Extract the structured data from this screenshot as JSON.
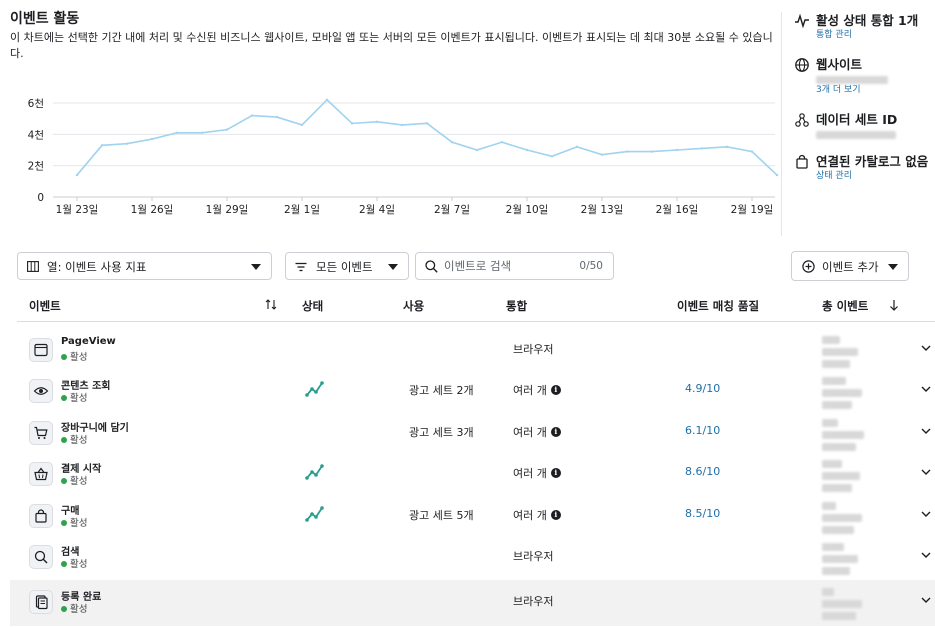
{
  "activity": {
    "title": "이벤트 활동",
    "description": "이 차트에는 선택한 기간 내에 처리 및 수신된 비즈니스 웹사이트, 모바일 앱 또는 서버의 모든 이벤트가 표시됩니다. 이벤트가 표시되는 데 최대 30분 소요될 수 있습니다."
  },
  "chart_data": {
    "type": "line",
    "title": "",
    "xlabel": "",
    "ylabel": "",
    "y_ticks": [
      "0",
      "2천",
      "4천",
      "6천"
    ],
    "ylim": [
      0,
      6000
    ],
    "x_tick_labels": [
      "1월 23일",
      "1월 26일",
      "1월 29일",
      "2월 1일",
      "2월 4일",
      "2월 7일",
      "2월 10일",
      "2월 13일",
      "2월 16일",
      "2월 19일"
    ],
    "x_tick_index": [
      0,
      3,
      6,
      9,
      12,
      15,
      18,
      21,
      24,
      27
    ],
    "x": [
      "1월 23일",
      "1월 24일",
      "1월 25일",
      "1월 26일",
      "1월 27일",
      "1월 28일",
      "1월 29일",
      "1월 30일",
      "1월 31일",
      "2월 1일",
      "2월 2일",
      "2월 3일",
      "2월 4일",
      "2월 5일",
      "2월 6일",
      "2월 7일",
      "2월 8일",
      "2월 9일",
      "2월 10일",
      "2월 11일",
      "2월 12일",
      "2월 13일",
      "2월 14일",
      "2월 15일",
      "2월 16일",
      "2월 17일",
      "2월 18일",
      "2월 19일",
      "2월 20일"
    ],
    "series": [
      {
        "color": "#9fd3ef",
        "values": [
          1400,
          3300,
          3400,
          3700,
          4100,
          4100,
          4300,
          5200,
          5100,
          4600,
          6200,
          4700,
          4800,
          4600,
          4700,
          3500,
          3000,
          3500,
          3000,
          2600,
          3200,
          2700,
          2900,
          2900,
          3000,
          3100,
          3200,
          2900,
          1400
        ]
      }
    ],
    "grid": true,
    "legend": "none"
  },
  "info": {
    "integration": {
      "title": "활성 상태 통합 1개",
      "link": "통합 관리"
    },
    "website": {
      "title": "웹사이트",
      "link": "3개 더 보기"
    },
    "dataset": {
      "title": "데이터 세트 ID"
    },
    "catalog": {
      "title": "연결된 카탈로그 없음",
      "link": "상태 관리"
    }
  },
  "toolbar": {
    "columns": "열: 이벤트 사용 지표",
    "filter": "모든 이벤트",
    "search_placeholder": "이벤트로 검색",
    "search_count": "0/50",
    "add_event": "이벤트 추가"
  },
  "table": {
    "headers": {
      "event": "이벤트",
      "status": "상태",
      "usage": "사용",
      "integration": "통합",
      "emq": "이벤트 매칭 품질",
      "total": "총 이벤트"
    },
    "rows": [
      {
        "name": "PageView",
        "status": "활성",
        "icon": "browser-window-icon",
        "usage": "",
        "integration": "브라우저",
        "integration_info": false,
        "emq": "",
        "trend": false
      },
      {
        "name": "콘텐츠 조회",
        "status": "활성",
        "icon": "eye-icon",
        "usage": "광고 세트 2개",
        "integration": "여러 개",
        "integration_info": true,
        "emq": "4.9/10",
        "trend": true
      },
      {
        "name": "장바구니에 담기",
        "status": "활성",
        "icon": "cart-icon",
        "usage": "광고 세트 3개",
        "integration": "여러 개",
        "integration_info": true,
        "emq": "6.1/10",
        "trend": false
      },
      {
        "name": "결제 시작",
        "status": "활성",
        "icon": "basket-icon",
        "usage": "",
        "integration": "여러 개",
        "integration_info": true,
        "emq": "8.6/10",
        "trend": true
      },
      {
        "name": "구매",
        "status": "활성",
        "icon": "shopping-bag-icon",
        "usage": "광고 세트 5개",
        "integration": "여러 개",
        "integration_info": true,
        "emq": "8.5/10",
        "trend": true
      },
      {
        "name": "검색",
        "status": "활성",
        "icon": "magnifier-icon",
        "usage": "",
        "integration": "브라우저",
        "integration_info": false,
        "emq": "",
        "trend": false
      },
      {
        "name": "등록 완료",
        "status": "활성",
        "icon": "registration-icon",
        "usage": "",
        "integration": "브라우저",
        "integration_info": false,
        "emq": "",
        "trend": false
      }
    ]
  },
  "info_glyph": "i"
}
